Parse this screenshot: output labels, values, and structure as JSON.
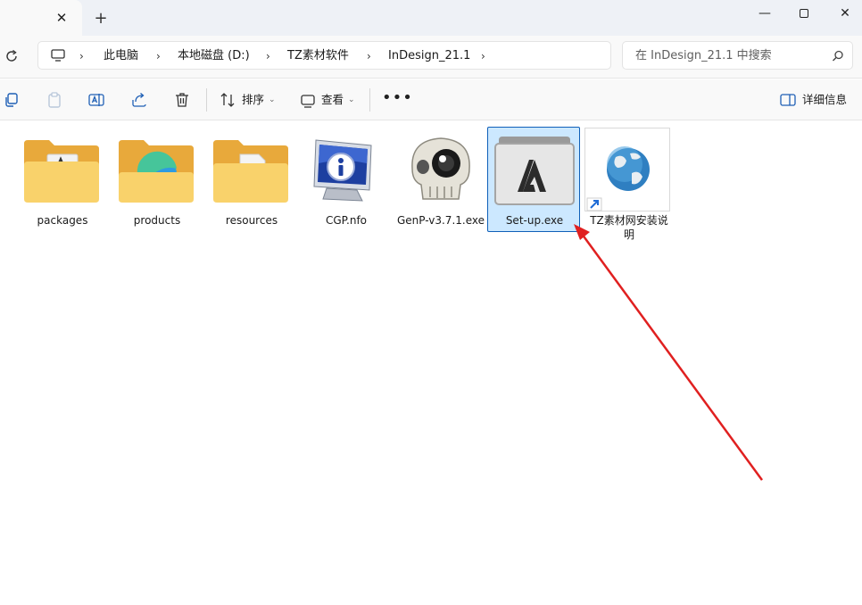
{
  "tab": {
    "close_glyph": "✕"
  },
  "new_tab_glyph": "+",
  "window": {
    "minimize_glyph": "—",
    "close_glyph": "✕"
  },
  "breadcrumb": [
    {
      "label": "此电脑"
    },
    {
      "label": "本地磁盘 (D:)"
    },
    {
      "label": "TZ素材软件"
    },
    {
      "label": "InDesign_21.1"
    }
  ],
  "search": {
    "placeholder": "在 InDesign_21.1 中搜索"
  },
  "toolbar": {
    "sort_label": "排序",
    "view_label": "查看",
    "more_label": "•••",
    "details_label": "详细信息"
  },
  "files": [
    {
      "name": "packages",
      "kind": "folder"
    },
    {
      "name": "products",
      "kind": "folder"
    },
    {
      "name": "resources",
      "kind": "folder"
    },
    {
      "name": "CGP.nfo",
      "kind": "nfo"
    },
    {
      "name": "GenP-v3.7.1.exe",
      "kind": "exe"
    },
    {
      "name": "Set-up.exe",
      "kind": "exe",
      "selected": true
    },
    {
      "name": "TZ素材网安装说明",
      "kind": "shortcut"
    }
  ],
  "colors": {
    "accent": "#0f5fb8",
    "selection": "#cce8ff",
    "folder": "#f4c253",
    "annotation_arrow": "#e02020"
  }
}
